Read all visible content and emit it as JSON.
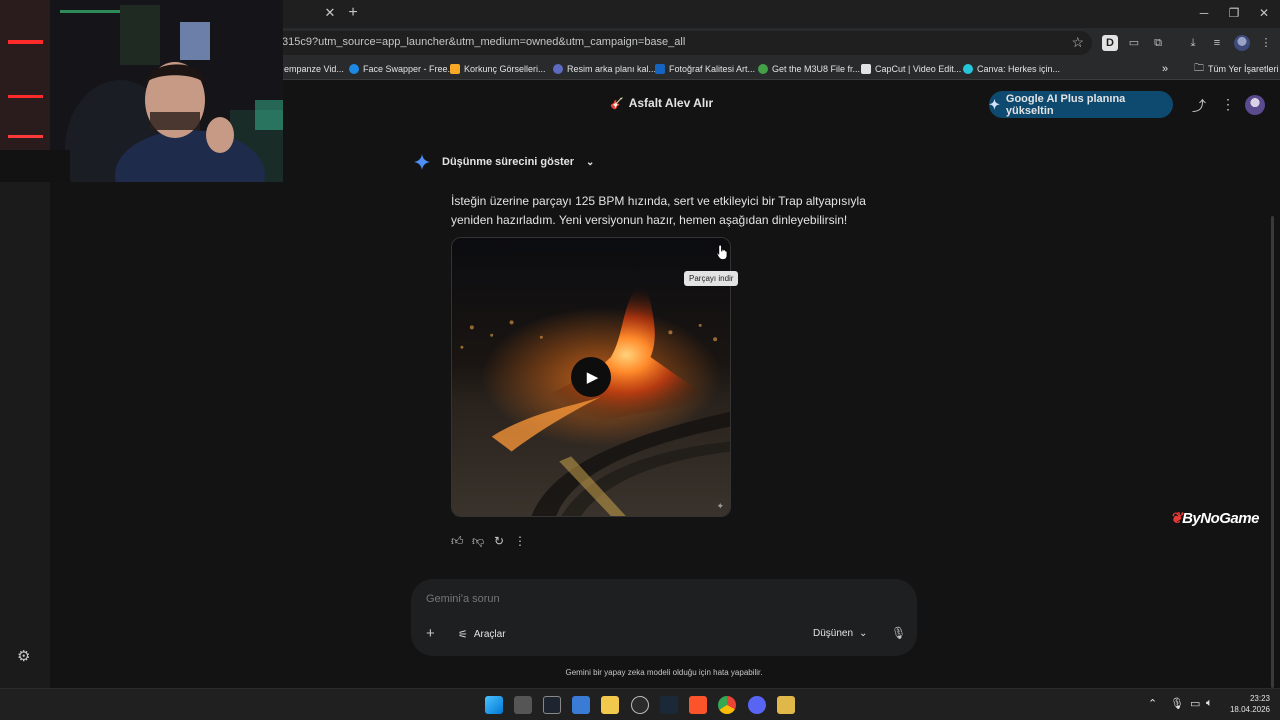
{
  "browser": {
    "url": "315c9?utm_source=app_launcher&utm_medium=owned&utm_campaign=base_all",
    "bookmarks": [
      "empanze Vid...",
      "Face Swapper - Free...",
      "Korkunç Görselleri...",
      "Resim arka planı kal...",
      "Fotoğraf Kalitesi Art...",
      "Get the M3U8 File fr...",
      "CapCut | Video Edit...",
      "Canva: Herkes için..."
    ],
    "all_bookmarks": "Tüm Yer İşaretleri",
    "overflow": "»"
  },
  "header": {
    "title": "Asfalt Alev Alır",
    "upgrade_label": "Google AI Plus planına yükseltin"
  },
  "thinking": {
    "label": "Düşünme sürecini göster"
  },
  "answer": {
    "text": "İsteğin üzerine parçayı 125 BPM hızında, sert ve etkileyici bir Trap altyapısıyla yeniden hazırladım. Yeni versiyonun hazır, hemen aşağıdan dinleyebilirsin!"
  },
  "media": {
    "tooltip": "Parçayı indir"
  },
  "composer": {
    "placeholder": "Gemini'a sorun",
    "tools_label": "Araçlar",
    "mode_label": "Düşünen"
  },
  "disclaimer": "Gemini bir yapay zeka modeli olduğu için hata yapabilir.",
  "watermark": "ByNoGame",
  "taskbar": {
    "time": "23:23",
    "date": "18.04.2026"
  },
  "colors": {
    "background": "#131314",
    "upgrade_button": "#0e4a6f",
    "composer": "#1e1f20"
  }
}
